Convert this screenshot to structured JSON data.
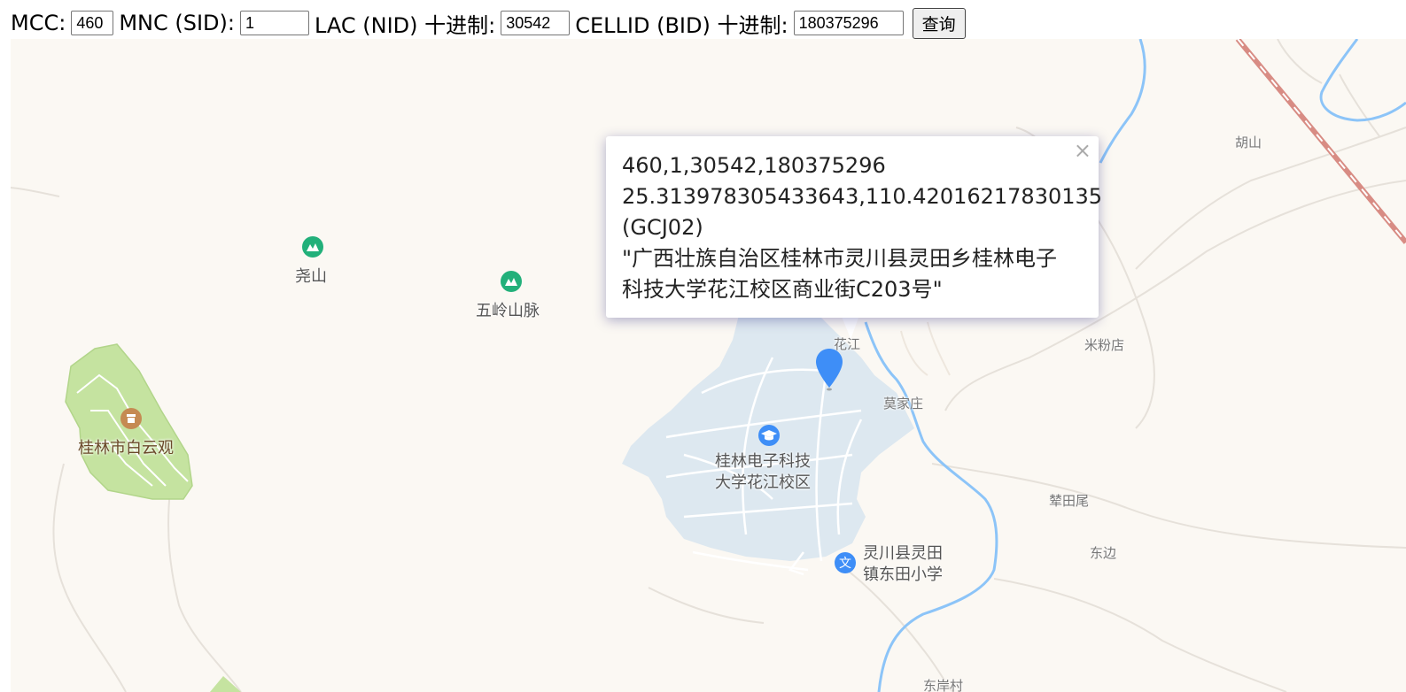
{
  "query": {
    "mcc_label": "MCC:",
    "mcc_value": "460",
    "mnc_label": "MNC (SID):",
    "mnc_value": "1",
    "lac_label": "LAC (NID) 十进制:",
    "lac_value": "30542",
    "cell_label": "CELLID (BID) 十进制:",
    "cell_value": "180375296",
    "submit_label": "查询"
  },
  "popup": {
    "line1": "460,1,30542,180375296",
    "line2": "25.313978305433643,110.42016217830135",
    "line3": "(GCJ02)",
    "line4": "\"广西壮族自治区桂林市灵川县灵田乡桂林电子",
    "line5": "科技大学花江校区商业街C203号\"",
    "close": "×"
  },
  "map": {
    "labels": {
      "hushan": "胡山",
      "yaoshan": "尧山",
      "wuling": "五岭山脉",
      "baiyunguan": "桂林市白云观",
      "huajiang": "花江",
      "mifendian": "米粉店",
      "mojiazhuang": "莫家庄",
      "university": "桂林电子科技大学花江校区",
      "pantianwei": "辇田尾",
      "dongbian": "东边",
      "school": "灵川县灵田镇东田小学",
      "dongancun": "东岸村"
    },
    "colors": {
      "background": "#fbf8f3",
      "park": "#c5e3a0",
      "campus": "#dde8f0",
      "river": "#8cc4f8",
      "marker": "#3e8ef7",
      "railway": "#d88c84"
    }
  }
}
